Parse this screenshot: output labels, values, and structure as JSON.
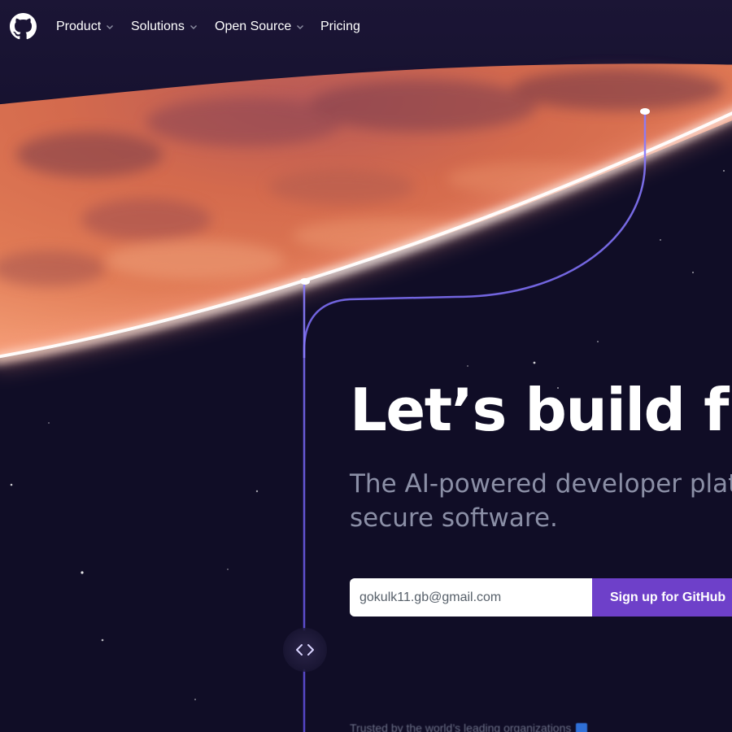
{
  "nav": {
    "items": [
      {
        "label": "Product",
        "has_dropdown": true
      },
      {
        "label": "Solutions",
        "has_dropdown": true
      },
      {
        "label": "Open Source",
        "has_dropdown": true
      },
      {
        "label": "Pricing",
        "has_dropdown": false
      }
    ],
    "logo_icon": "github-octocat-icon"
  },
  "hero": {
    "title": "Let’s build fr",
    "subtitle_line1": "The AI-powered developer platf",
    "subtitle_line2": "secure software."
  },
  "signup": {
    "email_value": "gokulk11.gb@gmail.com",
    "button_label": "Sign up for GitHub"
  },
  "badge": {
    "icon": "code-brackets-icon"
  },
  "trusted": {
    "text": "Trusted by the world’s leading organizations"
  },
  "colors": {
    "background": "#0d0b22",
    "accent": "#6e40c9",
    "planet": "#d9644a",
    "glow": "#fff1ea",
    "line": "#6c5ce7"
  }
}
